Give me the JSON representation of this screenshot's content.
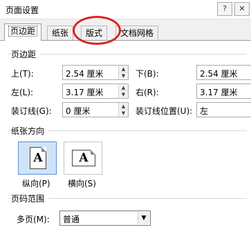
{
  "dialog": {
    "title": "页面设置",
    "help_label": "?",
    "close_label": "✕"
  },
  "tabs": [
    {
      "label": "页边距",
      "active": true
    },
    {
      "label": "纸张"
    },
    {
      "label": "版式"
    },
    {
      "label": "文档网格"
    }
  ],
  "margins": {
    "section_title": "页边距",
    "top": {
      "label": "上(T):",
      "value": "2.54 厘米"
    },
    "bottom": {
      "label": "下(B):",
      "value": "2.54 厘米"
    },
    "left": {
      "label": "左(L):",
      "value": "3.17 厘米"
    },
    "right": {
      "label": "右(R):",
      "value": "3.17 厘米"
    },
    "gutter": {
      "label": "装订线(G):",
      "value": "0 厘米"
    },
    "gutter_position": {
      "label": "装订线位置(U):",
      "value": "左"
    }
  },
  "orientation": {
    "section_title": "纸张方向",
    "portrait": {
      "label": "纵向(P)",
      "icon": "portrait-page-icon",
      "glyph": "A",
      "selected": true
    },
    "landscape": {
      "label": "横向(S)",
      "icon": "landscape-page-icon",
      "glyph": "A"
    }
  },
  "pages": {
    "section_title": "页码范围",
    "multiple_label": "多页(M):",
    "multiple_value": "普通"
  },
  "colors": {
    "highlight": "#e02020",
    "selected_bg": "#cfe3f8",
    "selected_border": "#5b8fd6"
  }
}
